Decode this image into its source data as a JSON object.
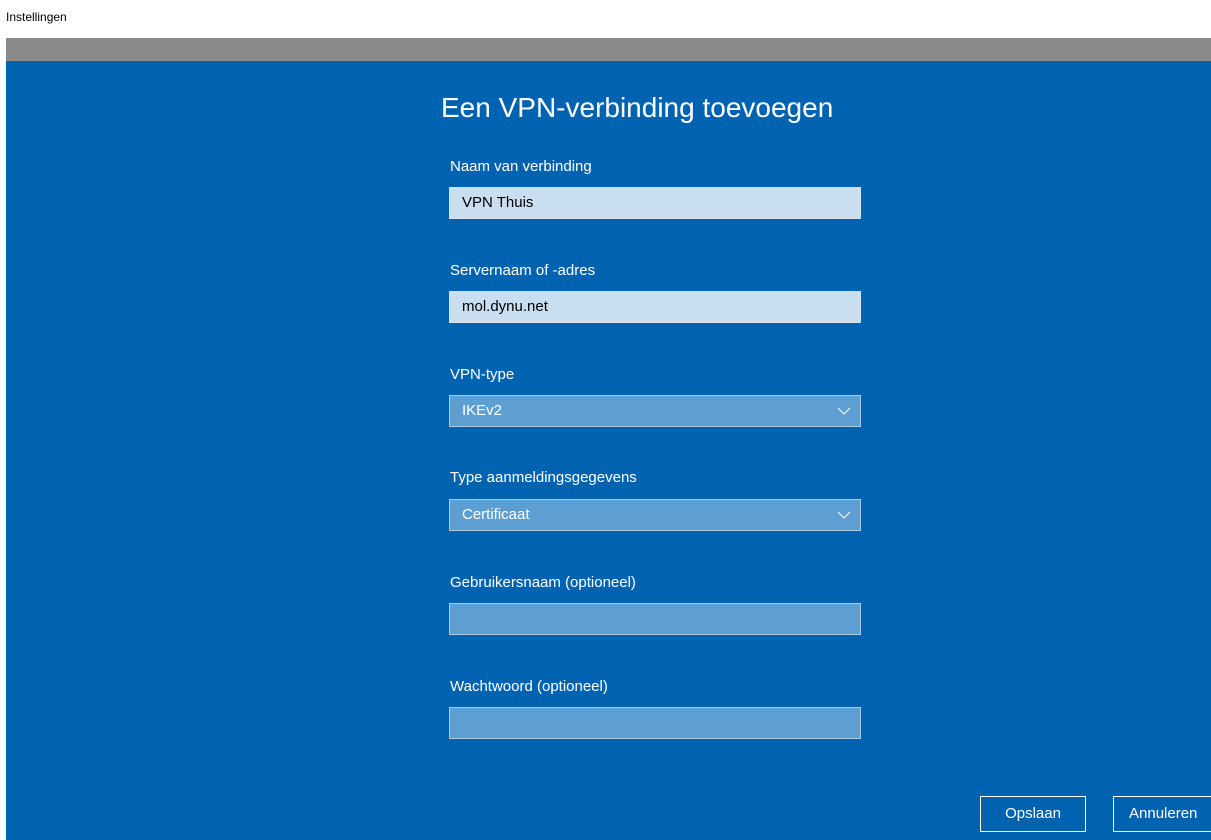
{
  "window": {
    "title": "Instellingen"
  },
  "dialog": {
    "heading": "Een VPN-verbinding toevoegen",
    "fields": {
      "connection_name": {
        "label": "Naam van verbinding",
        "value": "VPN Thuis"
      },
      "server": {
        "label": "Servernaam of -adres",
        "value": "mol.dynu.net"
      },
      "vpn_type": {
        "label": "VPN-type",
        "value": "IKEv2"
      },
      "credential_type": {
        "label": "Type aanmeldingsgegevens",
        "value": "Certificaat"
      },
      "username": {
        "label": "Gebruikersnaam (optioneel)",
        "value": ""
      },
      "password": {
        "label": "Wachtwoord (optioneel)",
        "value": ""
      }
    },
    "buttons": {
      "save": "Opslaan",
      "cancel": "Annuleren"
    }
  },
  "icons": {
    "dropdown": "chevron-down-icon"
  },
  "colors": {
    "panel": "#0063b1",
    "band": "#8a8a8a",
    "input_filled": "#c9def0",
    "input_dim": "#5d9ed3"
  }
}
